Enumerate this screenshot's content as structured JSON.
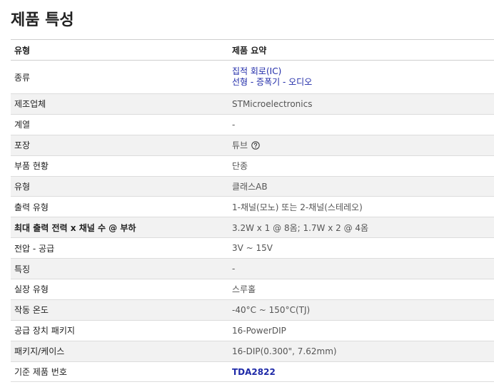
{
  "page": {
    "title": "제품 특성"
  },
  "table": {
    "header": {
      "attribute": "유형",
      "value": "제품 요약"
    },
    "rows": [
      {
        "label": "종류",
        "links": [
          "집적 회로(IC)",
          "선형 - 증폭기 - 오디오"
        ]
      },
      {
        "label": "제조업체",
        "value": "STMicroelectronics"
      },
      {
        "label": "계열",
        "value": "-"
      },
      {
        "label": "포장",
        "value": "튜브",
        "icon": "question-circle-icon"
      },
      {
        "label": "부품 현황",
        "value": "단종"
      },
      {
        "label": "유형",
        "value": "클래스AB"
      },
      {
        "label": "출력 유형",
        "value": "1-채널(모노) 또는 2-채널(스테레오)"
      },
      {
        "label": "최대 출력 전력 x 채널 수 @ 부하",
        "value": "3.2W x 1 @ 8옴; 1.7W x 2 @ 4옴"
      },
      {
        "label": "전압 - 공급",
        "value": "3V ~ 15V"
      },
      {
        "label": "특징",
        "value": "-"
      },
      {
        "label": "실장 유형",
        "value": "스루홀"
      },
      {
        "label": "작동 온도",
        "value": "-40°C ~ 150°C(TJ)"
      },
      {
        "label": "공급 장치 패키지",
        "value": "16-PowerDIP"
      },
      {
        "label": "패키지/케이스",
        "value": "16-DIP(0.300\", 7.62mm)"
      },
      {
        "label": "기준 제품 번호",
        "link": "TDA2822"
      }
    ]
  },
  "colors": {
    "link": "#1f2aa8",
    "stripe": "#f2f2f2",
    "border": "#dcdcdc"
  }
}
